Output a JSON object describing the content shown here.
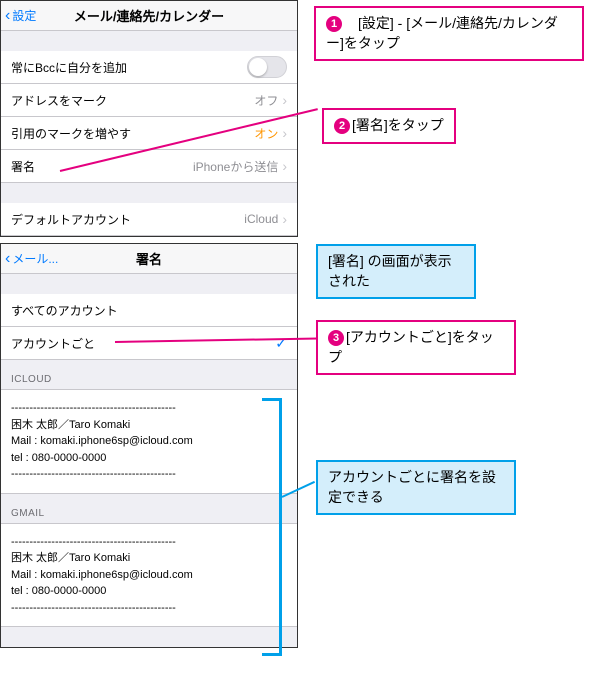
{
  "screen1": {
    "back": "設定",
    "title": "メール/連絡先/カレンダー",
    "rows": {
      "bcc": "常にBccに自分を追加",
      "markAddr": "アドレスをマーク",
      "markAddrVal": "オフ",
      "quote": "引用のマークを増やす",
      "quoteVal": "オン",
      "sig": "署名",
      "sigVal": "iPhoneから送信",
      "default": "デフォルトアカウント",
      "defaultVal": "iCloud"
    }
  },
  "screen2": {
    "back": "メール...",
    "title": "署名",
    "allAcct": "すべてのアカウント",
    "perAcct": "アカウントごと",
    "hdr1": "ICLOUD",
    "hdr2": "GMAIL",
    "sig1": "---------------------------------------------\n困木 太郎／Taro Komaki\nMail : komaki.iphone6sp@icloud.com\ntel : 080-0000-0000\n---------------------------------------------",
    "sig2": "---------------------------------------------\n困木 太郎／Taro Komaki\nMail : komaki.iphone6sp@icloud.com\ntel : 080-0000-0000\n---------------------------------------------"
  },
  "notes": {
    "n1": "　[設定] - [メール/連絡先/カレンダー]をタップ",
    "n2": "[署名]をタップ",
    "n3text": "[署名] の画面が表示された",
    "n3": "[アカウントごと]をタップ",
    "n4text": "アカウントごとに署名を設定できる",
    "num1": "1",
    "num2": "2",
    "num3": "3"
  }
}
